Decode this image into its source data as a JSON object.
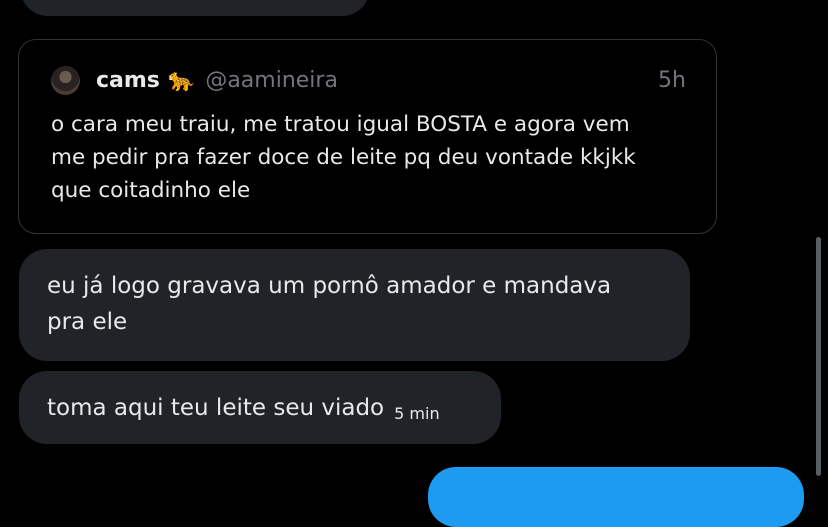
{
  "quote": {
    "display_name": "cams",
    "emoji": "🐆",
    "handle": "@aamineira",
    "time": "5h",
    "line1": "o cara meu traiu, me tratou igual BOSTA e agora vem",
    "line2": "me pedir pra fazer doce de leite pq deu vontade kkjkk",
    "line3": "que coitadinho ele"
  },
  "messages": [
    {
      "line1": "eu já logo gravava um pornô amador e mandava",
      "line2": "pra ele"
    },
    {
      "text": "toma aqui teu leite seu viado",
      "time": "5 min"
    }
  ],
  "colors": {
    "background": "#000000",
    "bubble": "#202327",
    "accent": "#1d9bf0",
    "muted_text": "#71767b"
  }
}
